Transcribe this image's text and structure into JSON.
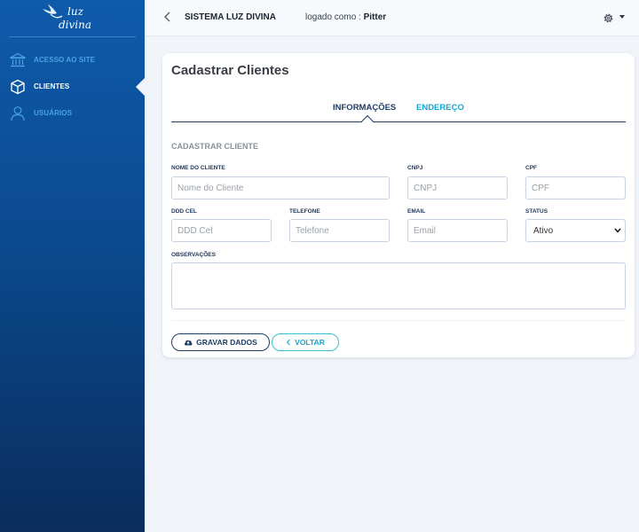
{
  "logo": {
    "text_top": "luz",
    "text_bottom": "divina",
    "icon": "dove-icon"
  },
  "sidebar": {
    "items": [
      {
        "label": "ACESSO AO SITE",
        "icon": "bank-icon",
        "active": false
      },
      {
        "label": "CLIENTES",
        "icon": "cube-icon",
        "active": true
      },
      {
        "label": "USUÁRIOS",
        "icon": "user-icon",
        "active": false
      }
    ]
  },
  "topbar": {
    "app_title": "SISTEMA LUZ DIVINA",
    "logged_prefix": "logado como :",
    "user": "Pitter"
  },
  "page": {
    "title": "Cadastrar Clientes"
  },
  "tabs": [
    {
      "label": "INFORMAÇÕES",
      "active": true
    },
    {
      "label": "ENDEREÇO",
      "active": false
    }
  ],
  "form": {
    "section_title": "CADASTRAR CLIENTE",
    "fields": {
      "nome": {
        "label": "NOME DO CLIENTE",
        "placeholder": "Nome do Cliente",
        "value": ""
      },
      "cnpj": {
        "label": "CNPJ",
        "placeholder": "CNPJ",
        "value": ""
      },
      "cpf": {
        "label": "CPF",
        "placeholder": "CPF",
        "value": ""
      },
      "ddd": {
        "label": "DDD CEL",
        "placeholder": "DDD Cel",
        "value": ""
      },
      "telefone": {
        "label": "TELEFONE",
        "placeholder": "Telefone",
        "value": ""
      },
      "email": {
        "label": "EMAIL",
        "placeholder": "Email",
        "value": ""
      },
      "status": {
        "label": "STATUS",
        "value": "Ativo"
      },
      "observacoes": {
        "label": "OBSERVAÇÕES",
        "value": ""
      }
    },
    "buttons": {
      "save": "GRAVAR DADOS",
      "back": "VOLTAR"
    }
  },
  "colors": {
    "sidebar_top": "#0e5bab",
    "sidebar_bottom": "#0a2d5c",
    "accent": "#18a8cf",
    "navy": "#1e3d64"
  }
}
